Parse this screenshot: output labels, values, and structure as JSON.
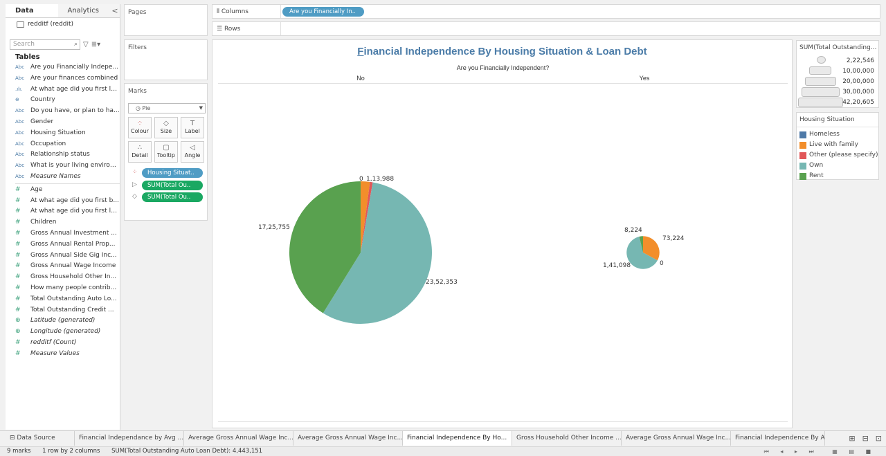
{
  "data_pane": {
    "tabs": [
      "Data",
      "Analytics"
    ],
    "collapse": "<",
    "datasource": "redditf (reddit)",
    "search_placeholder": "Search",
    "tables_heading": "Tables",
    "dimensions": [
      {
        "type": "Abc",
        "name": "Are you Financially Indepe..."
      },
      {
        "type": "Abc",
        "name": "Are your finances combined"
      },
      {
        "type": ".ılı.",
        "name": "At what age did you first le..."
      },
      {
        "type": "⊕",
        "name": "Country"
      },
      {
        "type": "Abc",
        "name": "Do you have, or plan to ha..."
      },
      {
        "type": "Abc",
        "name": "Gender"
      },
      {
        "type": "Abc",
        "name": "Housing Situation"
      },
      {
        "type": "Abc",
        "name": "Occupation"
      },
      {
        "type": "Abc",
        "name": "Relationship status"
      },
      {
        "type": "Abc",
        "name": "What is your living environ..."
      },
      {
        "type": "Abc",
        "name": "Measure Names",
        "italic": true
      }
    ],
    "measures": [
      {
        "type": "#",
        "name": "Age"
      },
      {
        "type": "#",
        "name": "At what age did you first b..."
      },
      {
        "type": "#",
        "name": "At what age did you first le..."
      },
      {
        "type": "#",
        "name": "Children"
      },
      {
        "type": "#",
        "name": "Gross Annual Investment ..."
      },
      {
        "type": "#",
        "name": "Gross Annual Rental Prop..."
      },
      {
        "type": "#",
        "name": "Gross Annual Side Gig Inc..."
      },
      {
        "type": "#",
        "name": "Gross Annual Wage Income"
      },
      {
        "type": "#",
        "name": "Gross Household Other In..."
      },
      {
        "type": "#",
        "name": "How many people contrib..."
      },
      {
        "type": "#",
        "name": "Total Outstanding Auto Lo..."
      },
      {
        "type": "#",
        "name": "Total Outstanding Credit ..."
      },
      {
        "type": "⊕",
        "name": "Latitude (generated)",
        "italic": true
      },
      {
        "type": "⊕",
        "name": "Longitude (generated)",
        "italic": true
      },
      {
        "type": "#",
        "name": "redditf (Count)",
        "italic": true
      },
      {
        "type": "#",
        "name": "Measure Values",
        "italic": true
      }
    ]
  },
  "cards": {
    "pages": "Pages",
    "filters": "Filters",
    "marks": "Marks",
    "mark_type": "◷ Pie",
    "buttons": [
      {
        "icon": "⁘",
        "label": "Colour"
      },
      {
        "icon": "◇",
        "label": "Size"
      },
      {
        "icon": "T",
        "label": "Label"
      },
      {
        "icon": "∴",
        "label": "Detail"
      },
      {
        "icon": "▢",
        "label": "Tooltip"
      },
      {
        "icon": "◁",
        "label": "Angle"
      }
    ],
    "pills": [
      {
        "icon": "⁘",
        "label": "Housing Situat..",
        "color": "blue"
      },
      {
        "icon": "▷",
        "label": "SUM(Total Ou..",
        "color": "green"
      },
      {
        "icon": "◇",
        "label": "SUM(Total Ou..",
        "color": "green"
      }
    ]
  },
  "shelves": {
    "columns_label": "Columns",
    "columns_pill": "Are you Financially In..",
    "rows_label": "Rows"
  },
  "view": {
    "title_first": "F",
    "title_rest": "inancial Independence By Housing Situation & Loan Debt",
    "column_title": "Are you Financially Independent?",
    "col_no": "No",
    "col_yes": "Yes"
  },
  "chart_data": {
    "type": "pie",
    "title": "Financial Independence By Housing Situation & Loan Debt",
    "column_field": "Are you Financially Independent?",
    "color_field": "Housing Situation",
    "colors": {
      "Homeless": "#4e79a7",
      "Live with family": "#f28e2b",
      "Other (please specify)": "#e15759",
      "Own": "#76b7b2",
      "Rent": "#59a14f"
    },
    "pies": [
      {
        "column": "No",
        "total": 4192096,
        "slices": [
          {
            "category": "Homeless",
            "value": 0,
            "label": "0"
          },
          {
            "category": "Live with family",
            "value": 88000,
            "label": "1,13,988"
          },
          {
            "category": "Other (please specify)",
            "value": 25988,
            "label": ""
          },
          {
            "category": "Own",
            "value": 2352353,
            "label": "23,52,353"
          },
          {
            "category": "Rent",
            "value": 1725755,
            "label": "17,25,755"
          }
        ]
      },
      {
        "column": "Yes",
        "total": 222546,
        "slices": [
          {
            "category": "Homeless",
            "value": 0,
            "label": ""
          },
          {
            "category": "Live with family",
            "value": 73224,
            "label": "73,224"
          },
          {
            "category": "Other (please specify)",
            "value": 0,
            "label": "0"
          },
          {
            "category": "Own",
            "value": 141098,
            "label": "1,41,098"
          },
          {
            "category": "Rent",
            "value": 8224,
            "label": "8,224"
          }
        ]
      }
    ]
  },
  "size_legend": {
    "title": "SUM(Total Outstanding...",
    "values": [
      "2,22,546",
      "10,00,000",
      "20,00,000",
      "30,00,000",
      "42,20,605"
    ]
  },
  "color_legend": {
    "title": "Housing Situation",
    "items": [
      {
        "label": "Homeless",
        "color": "#4e79a7"
      },
      {
        "label": "Live with family",
        "color": "#f28e2b"
      },
      {
        "label": "Other (please specify)",
        "color": "#e15759"
      },
      {
        "label": "Own",
        "color": "#76b7b2"
      },
      {
        "label": "Rent",
        "color": "#59a14f"
      }
    ]
  },
  "sheet_tabs": [
    {
      "label": "⊟ Data Source",
      "w": 100
    },
    {
      "label": "Financial Independance by Avg ...",
      "w": 158
    },
    {
      "label": "Average Gross Annual Wage Inc...",
      "w": 158
    },
    {
      "label": "Average Gross Annual Wage Inc...",
      "w": 158
    },
    {
      "label": "Financial Independence By Ho...",
      "w": 158,
      "active": true
    },
    {
      "label": "Gross Household Other Income ...",
      "w": 158
    },
    {
      "label": "Average Gross Annual Wage Inc...",
      "w": 158
    },
    {
      "label": "Financial Independence By Ave",
      "w": 136
    }
  ],
  "status": {
    "marks": "9 marks",
    "dims": "1 row by 2 columns",
    "sum": "SUM(Total Outstanding Auto Loan Debt): 4,443,151"
  }
}
